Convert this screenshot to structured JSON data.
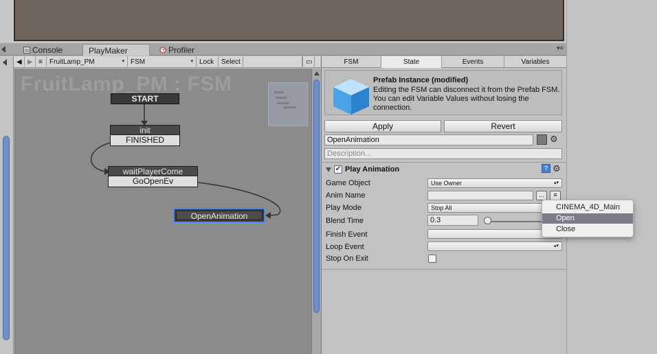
{
  "tabs": [
    {
      "label": "Console",
      "icon": "console-icon"
    },
    {
      "label": "PlayMaker",
      "icon": ""
    },
    {
      "label": "Profiler",
      "icon": "profiler-icon"
    }
  ],
  "graph_toolbar": {
    "gameobject": "FruitLamp_PM",
    "fsm": "FSM",
    "lock": "Lock",
    "select": "Select"
  },
  "graph": {
    "watermark": "FruitLamp_PM : FSM",
    "start": "START",
    "states": [
      {
        "name": "init",
        "transition": "FINISHED"
      },
      {
        "name": "waitPlayerCome",
        "transition": "GoOpenEv"
      },
      {
        "name": "OpenAnimation",
        "transition": ""
      }
    ]
  },
  "inspector": {
    "tabs": [
      "FSM",
      "State",
      "Events",
      "Variables"
    ],
    "active_tab": "State",
    "prefab_title": "Prefab Instance (modified)",
    "prefab_desc": "Editing the FSM can disconnect it from the Prefab FSM. You can edit Variable Values without losing the connection.",
    "apply": "Apply",
    "revert": "Revert",
    "state_name": "OpenAnimation",
    "description_placeholder": "Description...",
    "action": {
      "title": "Play Animation",
      "enabled": true,
      "params": [
        {
          "label": "Game Object",
          "value": "Use Owner"
        },
        {
          "label": "Anim Name",
          "value": ""
        },
        {
          "label": "Play Mode",
          "value": "Stop All"
        },
        {
          "label": "Blend Time",
          "value": "0.3",
          "slider": 0.09
        },
        {
          "label": "Finish Event",
          "value": ""
        },
        {
          "label": "Loop Event",
          "value": ""
        },
        {
          "label": "Stop On Exit",
          "checked": false
        }
      ]
    }
  },
  "popup": {
    "options": [
      "CINEMA_4D_Main",
      "Open",
      "Close"
    ],
    "selected": "Open"
  },
  "colors": {
    "graph_bg": "#8b8b8b",
    "selection": "#4a8af0",
    "scrollbar": "#6f8fc8"
  }
}
